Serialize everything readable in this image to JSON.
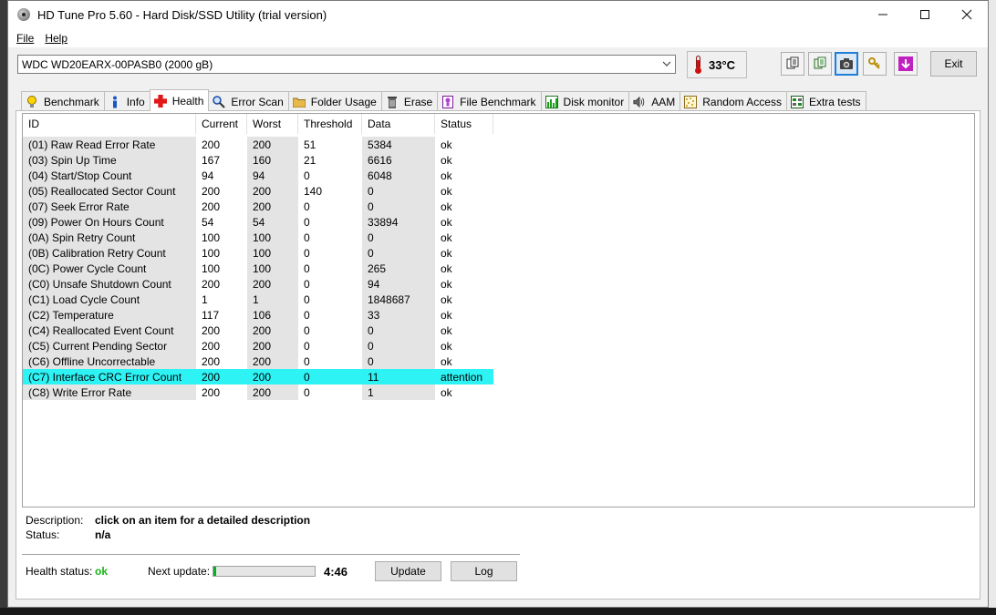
{
  "window": {
    "title": "HD Tune Pro 5.60 - Hard Disk/SSD Utility (trial version)"
  },
  "menu": [
    {
      "label": "File"
    },
    {
      "label": "Help"
    }
  ],
  "toolbar": {
    "drive": "WDC WD20EARX-00PASB0 (2000 gB)",
    "temperature": "33°C",
    "exit_label": "Exit",
    "icons": [
      "copy-text-icon",
      "copy-info-icon",
      "camera-icon",
      "keys-icon",
      "download-icon"
    ]
  },
  "tabs": [
    {
      "label": "Benchmark",
      "icon": "lightbulb-icon"
    },
    {
      "label": "Info",
      "icon": "info-icon"
    },
    {
      "label": "Health",
      "icon": "red-cross-icon",
      "active": true
    },
    {
      "label": "Error Scan",
      "icon": "magnifier-icon"
    },
    {
      "label": "Folder Usage",
      "icon": "folder-icon"
    },
    {
      "label": "Erase",
      "icon": "trash-icon"
    },
    {
      "label": "File Benchmark",
      "icon": "file-benchmark-icon"
    },
    {
      "label": "Disk monitor",
      "icon": "chart-icon"
    },
    {
      "label": "AAM",
      "icon": "speaker-icon"
    },
    {
      "label": "Random Access",
      "icon": "random-dots-icon"
    },
    {
      "label": "Extra tests",
      "icon": "extra-tests-icon"
    }
  ],
  "table": {
    "columns": [
      "ID",
      "Current",
      "Worst",
      "Threshold",
      "Data",
      "Status"
    ],
    "rows": [
      [
        "(01) Raw Read Error Rate",
        "200",
        "200",
        "51",
        "5384",
        "ok"
      ],
      [
        "(03) Spin Up Time",
        "167",
        "160",
        "21",
        "6616",
        "ok"
      ],
      [
        "(04) Start/Stop Count",
        "94",
        "94",
        "0",
        "6048",
        "ok"
      ],
      [
        "(05) Reallocated Sector Count",
        "200",
        "200",
        "140",
        "0",
        "ok"
      ],
      [
        "(07) Seek Error Rate",
        "200",
        "200",
        "0",
        "0",
        "ok"
      ],
      [
        "(09) Power On Hours Count",
        "54",
        "54",
        "0",
        "33894",
        "ok"
      ],
      [
        "(0A) Spin Retry Count",
        "100",
        "100",
        "0",
        "0",
        "ok"
      ],
      [
        "(0B) Calibration Retry Count",
        "100",
        "100",
        "0",
        "0",
        "ok"
      ],
      [
        "(0C) Power Cycle Count",
        "100",
        "100",
        "0",
        "265",
        "ok"
      ],
      [
        "(C0) Unsafe Shutdown Count",
        "200",
        "200",
        "0",
        "94",
        "ok"
      ],
      [
        "(C1) Load Cycle Count",
        "1",
        "1",
        "0",
        "1848687",
        "ok"
      ],
      [
        "(C2) Temperature",
        "117",
        "106",
        "0",
        "33",
        "ok"
      ],
      [
        "(C4) Reallocated Event Count",
        "200",
        "200",
        "0",
        "0",
        "ok"
      ],
      [
        "(C5) Current Pending Sector",
        "200",
        "200",
        "0",
        "0",
        "ok"
      ],
      [
        "(C6) Offline Uncorrectable",
        "200",
        "200",
        "0",
        "0",
        "ok"
      ],
      [
        "(C7) Interface CRC Error Count",
        "200",
        "200",
        "0",
        "11",
        "attention"
      ],
      [
        "(C8) Write Error Rate",
        "200",
        "200",
        "0",
        "1",
        "ok"
      ]
    ]
  },
  "details": {
    "description_label": "Description:",
    "description_value": "click on an item for a detailed description",
    "status_label": "Status:",
    "status_value": "n/a"
  },
  "footer": {
    "health_label": "Health status:",
    "health_value": "ok",
    "next_update_label": "Next update:",
    "progress": 0.03,
    "countdown": "4:46",
    "update_label": "Update",
    "log_label": "Log"
  },
  "colors": {
    "attention_row": "#2ef3f5",
    "health_ok": "#18b418",
    "progress_fill": "#06b025"
  }
}
